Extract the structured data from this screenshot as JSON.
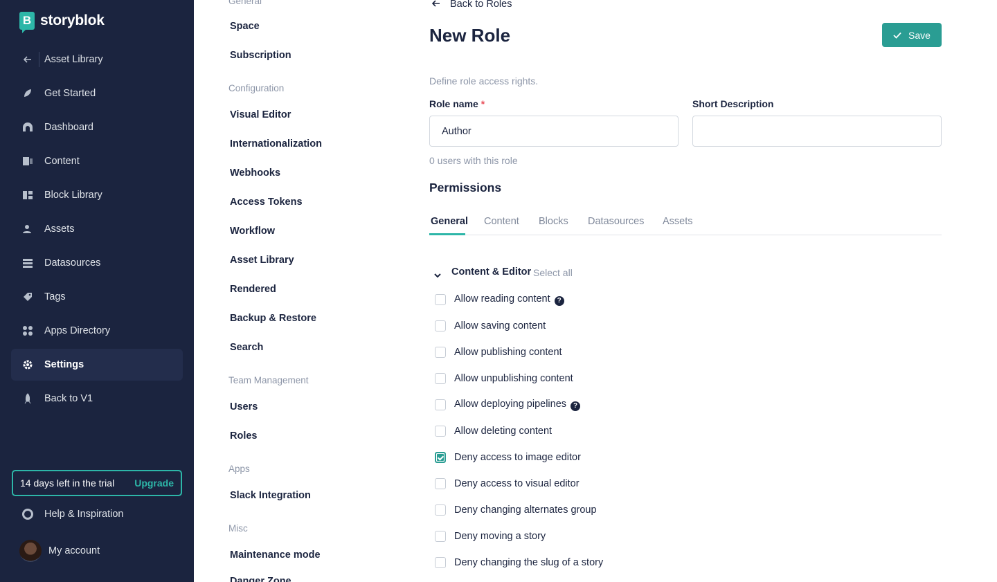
{
  "brand": {
    "name": "storyblok",
    "mark": "B"
  },
  "sidebar": {
    "back": {
      "label": "Asset Library",
      "icon": "arrow-left-icon"
    },
    "items": [
      {
        "label": "Get Started",
        "icon": "rocket-icon"
      },
      {
        "label": "Dashboard",
        "icon": "dashboard-icon"
      },
      {
        "label": "Content",
        "icon": "content-icon"
      },
      {
        "label": "Block Library",
        "icon": "blocks-icon"
      },
      {
        "label": "Assets",
        "icon": "assets-icon"
      },
      {
        "label": "Datasources",
        "icon": "datasources-icon"
      },
      {
        "label": "Tags",
        "icon": "tag-icon"
      },
      {
        "label": "Apps Directory",
        "icon": "apps-icon"
      },
      {
        "label": "Settings",
        "icon": "gear-icon",
        "active": true
      },
      {
        "label": "Back to V1",
        "icon": "rocket-icon"
      }
    ],
    "trial": {
      "text": "14 days left in the trial",
      "upgrade": "Upgrade"
    },
    "help": "Help & Inspiration",
    "account": "My account"
  },
  "settings_nav": {
    "general_heading": "General",
    "general": [
      "Space",
      "Subscription"
    ],
    "configuration_heading": "Configuration",
    "configuration": [
      "Visual Editor",
      "Internationalization",
      "Webhooks",
      "Access Tokens",
      "Workflow",
      "Asset Library",
      "Rendered",
      "Backup & Restore",
      "Search"
    ],
    "team_heading": "Team Management",
    "team": [
      "Users",
      "Roles"
    ],
    "apps_heading": "Apps",
    "apps": [
      "Slack Integration"
    ],
    "misc_heading": "Misc",
    "misc": [
      "Maintenance mode",
      "Danger Zone"
    ]
  },
  "main": {
    "back_link": "Back to Roles",
    "title": "New Role",
    "save_label": "Save",
    "description": "Define role access rights.",
    "role_name_label": "Role name",
    "required_mark": "*",
    "role_name_value": "Author",
    "short_description_label": "Short Description",
    "short_description_value": "",
    "users_count": "0 users with this role",
    "permissions_title": "Permissions",
    "tabs": [
      "General",
      "Content",
      "Blocks",
      "Datasources",
      "Assets"
    ],
    "active_tab": "General",
    "group": {
      "title": "Content & Editor",
      "select_all": "Select all"
    },
    "permissions": [
      {
        "label": "Allow reading content",
        "checked": false,
        "help": true
      },
      {
        "label": "Allow saving content",
        "checked": false
      },
      {
        "label": "Allow publishing content",
        "checked": false
      },
      {
        "label": "Allow unpublishing content",
        "checked": false
      },
      {
        "label": "Allow deploying pipelines",
        "checked": false,
        "help": true
      },
      {
        "label": "Allow deleting content",
        "checked": false
      },
      {
        "label": "Deny access to image editor",
        "checked": true
      },
      {
        "label": "Deny access to visual editor",
        "checked": false
      },
      {
        "label": "Deny changing alternates group",
        "checked": false
      },
      {
        "label": "Deny moving a story",
        "checked": false
      },
      {
        "label": "Deny changing the slug of a story",
        "checked": false
      }
    ]
  },
  "colors": {
    "sidebar": "#1b243f",
    "accent": "#2db6a8",
    "button": "#2a9d93"
  }
}
